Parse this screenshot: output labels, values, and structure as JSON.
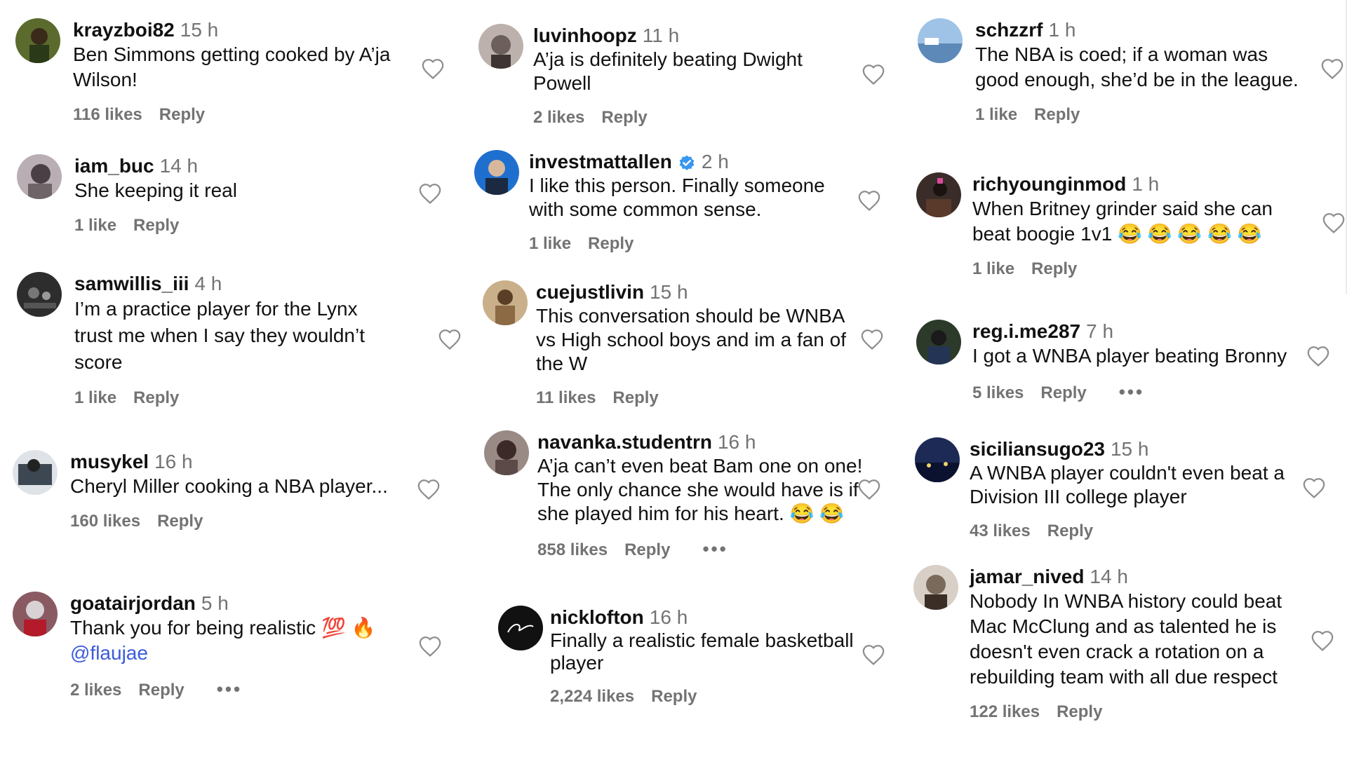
{
  "columns": [
    {
      "comments": [
        {
          "username": "krayzboi82",
          "time": "15 h",
          "lines": [
            "Ben Simmons getting cooked by A’ja",
            "Wilson!"
          ],
          "likes": "116 likes",
          "reply": "Reply",
          "avatar_color": "#5b6b2e"
        },
        {
          "username": "iam_buc",
          "time": "14 h",
          "lines": [
            "She keeping it real"
          ],
          "likes": "1 like",
          "reply": "Reply",
          "avatar_color": "#7a6f73"
        },
        {
          "username": "samwillis_iii",
          "time": "4 h",
          "lines": [
            "I’m a practice player for the Lynx",
            "trust me when I say they wouldn’t",
            "score"
          ],
          "likes": "1 like",
          "reply": "Reply",
          "avatar_color": "#2d2d2d"
        },
        {
          "username": "musykel",
          "time": "16 h",
          "lines": [
            "Cheryl Miller cooking a NBA player..."
          ],
          "likes": "160 likes",
          "reply": "Reply",
          "avatar_color": "#3c4752"
        },
        {
          "username": "goatairjordan",
          "time": "5 h",
          "lines": [
            "Thank you for being realistic 💯 🔥"
          ],
          "mention": "@flaujae",
          "likes": "2 likes",
          "reply": "Reply",
          "more": "•••",
          "avatar_color": "#8a5a63"
        }
      ]
    },
    {
      "comments": [
        {
          "username": "luvinhoopz",
          "time": "11 h",
          "lines": [
            "A’ja is definitely beating Dwight",
            "Powell"
          ],
          "likes": "2 likes",
          "reply": "Reply",
          "avatar_color": "#6d5f5c"
        },
        {
          "username": "investmattallen",
          "time": "2 h",
          "verified": true,
          "lines": [
            "I like this person. Finally someone",
            "with some common sense."
          ],
          "likes": "1 like",
          "reply": "Reply",
          "avatar_color": "#1f6fcf"
        },
        {
          "username": "cuejustlivin",
          "time": "15 h",
          "lines": [
            "This conversation should be WNBA",
            "vs High school boys and im a fan of",
            "the W"
          ],
          "likes": "11 likes",
          "reply": "Reply",
          "avatar_color": "#8b6a44"
        },
        {
          "username": "navanka.studentrn",
          "time": "16 h",
          "lines": [
            "A’ja can’t even beat Bam one on one!",
            "The only chance she would have is if",
            "she played him for his heart. 😂 😂"
          ],
          "likes": "858 likes",
          "reply": "Reply",
          "more": "•••",
          "avatar_color": "#5b4a47"
        },
        {
          "username": "nicklofton",
          "time": "16 h",
          "lines": [
            "Finally a realistic female basketball",
            "player"
          ],
          "likes": "2,224 likes",
          "reply": "Reply",
          "avatar_color": "#111111"
        }
      ]
    },
    {
      "comments": [
        {
          "username": "schzzrf",
          "time": "1 h",
          "lines": [
            "The NBA is coed; if a woman was",
            "good enough, she’d be in the league."
          ],
          "likes": "1 like",
          "reply": "Reply",
          "avatar_color": "#5d89b8"
        },
        {
          "username": "richyounginmod",
          "time": "1 h",
          "lines": [
            "When Britney grinder said she can",
            "beat boogie 1v1 😂 😂 😂 😂 😂"
          ],
          "likes": "1 like",
          "reply": "Reply",
          "avatar_color": "#3a2c28"
        },
        {
          "username": "reg.i.me287",
          "time": "7 h",
          "lines": [
            "I got a WNBA player beating Bronny"
          ],
          "likes": "5 likes",
          "reply": "Reply",
          "more": "•••",
          "avatar_color": "#2c3a2a"
        },
        {
          "username": "siciliansugo23",
          "time": "15 h",
          "lines": [
            "A WNBA player couldn't even beat a",
            "Division III college player"
          ],
          "likes": "43 likes",
          "reply": "Reply",
          "avatar_color": "#1d2a55"
        },
        {
          "username": "jamar_nived",
          "time": "14 h",
          "lines": [
            "Nobody In WNBA history could beat",
            "Mac McClung and as talented he is",
            "doesn't even crack a rotation on a",
            "rebuilding team with all due respect"
          ],
          "likes": "122 likes",
          "reply": "Reply",
          "avatar_color": "#7a6a5c"
        }
      ]
    }
  ]
}
